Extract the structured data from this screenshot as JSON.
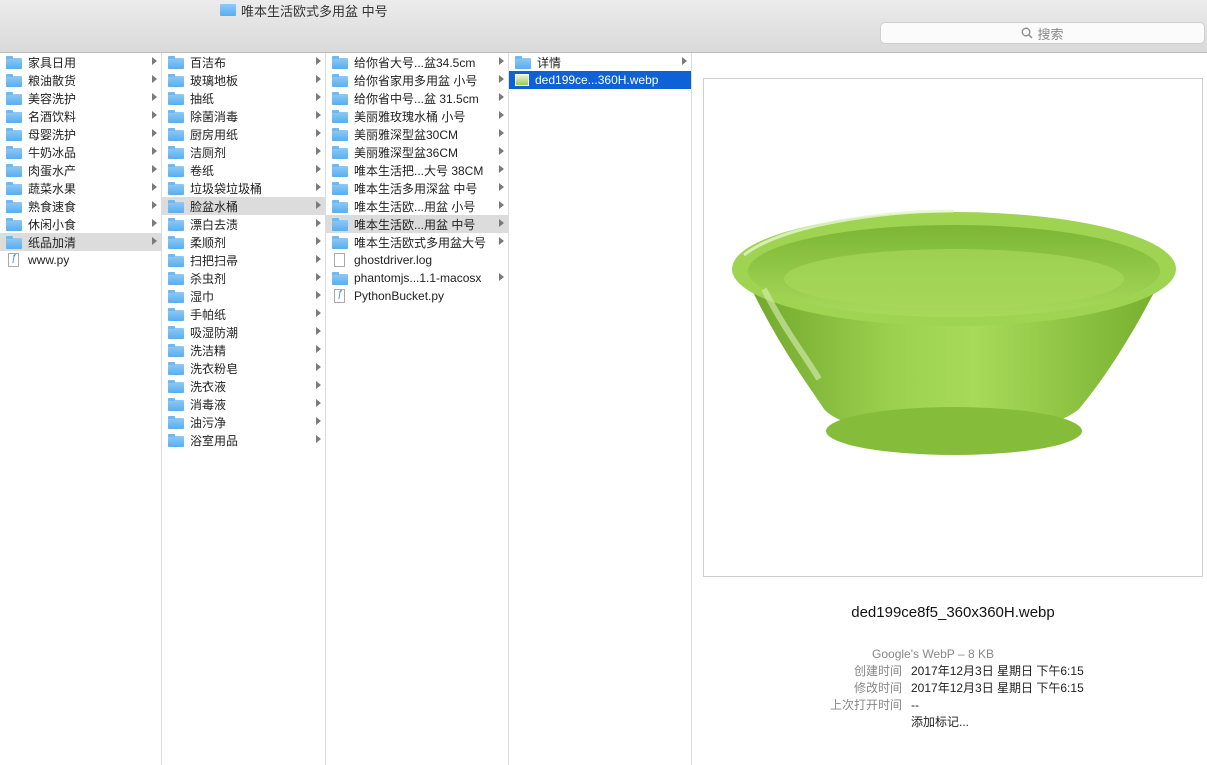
{
  "window": {
    "title": "唯本生活欧式多用盆 中号",
    "search_placeholder": "搜索"
  },
  "column1": [
    {
      "label": "家具日用",
      "type": "folder",
      "arrow": true
    },
    {
      "label": "粮油散货",
      "type": "folder",
      "arrow": true
    },
    {
      "label": "美容洗护",
      "type": "folder",
      "arrow": true
    },
    {
      "label": "名酒饮料",
      "type": "folder",
      "arrow": true
    },
    {
      "label": "母婴洗护",
      "type": "folder",
      "arrow": true
    },
    {
      "label": "牛奶冰品",
      "type": "folder",
      "arrow": true
    },
    {
      "label": "肉蛋水产",
      "type": "folder",
      "arrow": true
    },
    {
      "label": "蔬菜水果",
      "type": "folder",
      "arrow": true
    },
    {
      "label": "熟食速食",
      "type": "folder",
      "arrow": true
    },
    {
      "label": "休闲小食",
      "type": "folder",
      "arrow": true
    },
    {
      "label": "纸品加清",
      "type": "folder",
      "arrow": true,
      "selected": true
    },
    {
      "label": "www.py",
      "type": "py",
      "arrow": false
    }
  ],
  "column2": [
    {
      "label": "百洁布",
      "type": "folder",
      "arrow": true
    },
    {
      "label": "玻璃地板",
      "type": "folder",
      "arrow": true
    },
    {
      "label": "抽纸",
      "type": "folder",
      "arrow": true
    },
    {
      "label": "除菌消毒",
      "type": "folder",
      "arrow": true
    },
    {
      "label": "厨房用纸",
      "type": "folder",
      "arrow": true
    },
    {
      "label": "洁厕剂",
      "type": "folder",
      "arrow": true
    },
    {
      "label": "卷纸",
      "type": "folder",
      "arrow": true
    },
    {
      "label": "垃圾袋垃圾桶",
      "type": "folder",
      "arrow": true
    },
    {
      "label": "脸盆水桶",
      "type": "folder",
      "arrow": true,
      "selected": true
    },
    {
      "label": "漂白去渍",
      "type": "folder",
      "arrow": true
    },
    {
      "label": "柔顺剂",
      "type": "folder",
      "arrow": true
    },
    {
      "label": "扫把扫帚",
      "type": "folder",
      "arrow": true
    },
    {
      "label": "杀虫剂",
      "type": "folder",
      "arrow": true
    },
    {
      "label": "湿巾",
      "type": "folder",
      "arrow": true
    },
    {
      "label": "手帕纸",
      "type": "folder",
      "arrow": true
    },
    {
      "label": "吸湿防潮",
      "type": "folder",
      "arrow": true
    },
    {
      "label": "洗洁精",
      "type": "folder",
      "arrow": true
    },
    {
      "label": "洗衣粉皂",
      "type": "folder",
      "arrow": true
    },
    {
      "label": "洗衣液",
      "type": "folder",
      "arrow": true
    },
    {
      "label": "消毒液",
      "type": "folder",
      "arrow": true
    },
    {
      "label": "油污净",
      "type": "folder",
      "arrow": true
    },
    {
      "label": "浴室用品",
      "type": "folder",
      "arrow": true
    }
  ],
  "column3": [
    {
      "label": "给你省大号...盆34.5cm",
      "type": "folder",
      "arrow": true
    },
    {
      "label": "给你省家用多用盆 小号",
      "type": "folder",
      "arrow": true
    },
    {
      "label": "给你省中号...盆 31.5cm",
      "type": "folder",
      "arrow": true
    },
    {
      "label": "美丽雅玫瑰水桶 小号",
      "type": "folder",
      "arrow": true
    },
    {
      "label": "美丽雅深型盆30CM",
      "type": "folder",
      "arrow": true
    },
    {
      "label": "美丽雅深型盆36CM",
      "type": "folder",
      "arrow": true
    },
    {
      "label": "唯本生活把...大号 38CM",
      "type": "folder",
      "arrow": true
    },
    {
      "label": "唯本生活多用深盆 中号",
      "type": "folder",
      "arrow": true
    },
    {
      "label": "唯本生活欧...用盆 小号",
      "type": "folder",
      "arrow": true
    },
    {
      "label": "唯本生活欧...用盆 中号",
      "type": "folder",
      "arrow": true,
      "selected": true
    },
    {
      "label": "唯本生活欧式多用盆大号",
      "type": "folder",
      "arrow": true
    },
    {
      "label": "ghostdriver.log",
      "type": "doc",
      "arrow": false
    },
    {
      "label": "phantomjs...1.1-macosx",
      "type": "folder",
      "arrow": true
    },
    {
      "label": "PythonBucket.py",
      "type": "py",
      "arrow": false
    }
  ],
  "column4": [
    {
      "label": "详情",
      "type": "folder",
      "arrow": true
    },
    {
      "label": "ded199ce...360H.webp",
      "type": "image",
      "arrow": false,
      "active": true
    }
  ],
  "preview": {
    "filename": "ded199ce8f5_360x360H.webp",
    "kind": "Google's WebP – 8 KB",
    "created_label": "创建时间",
    "created_value": "2017年12月3日 星期日 下午6:15",
    "modified_label": "修改时间",
    "modified_value": "2017年12月3日 星期日 下午6:15",
    "opened_label": "上次打开时间",
    "opened_value": "--",
    "add_tags": "添加标记..."
  },
  "colors": {
    "selection": "#0f62d6",
    "folder": "#6cb9f3",
    "basin": "#8cc63f"
  }
}
